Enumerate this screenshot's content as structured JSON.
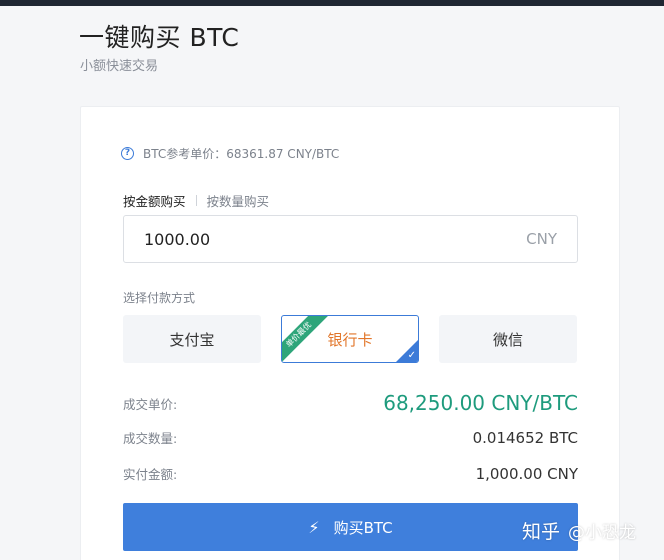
{
  "header": {
    "title": "一键购买 BTC",
    "subtitle": "小额快速交易"
  },
  "reference": {
    "text": "BTC参考单价：68361.87 CNY/BTC",
    "icon": "question-circle-icon"
  },
  "mode_tabs": {
    "by_amount": "按金额购买",
    "by_quantity": "按数量购买"
  },
  "amount": {
    "value": "1000.00",
    "unit": "CNY"
  },
  "payment": {
    "label": "选择付款方式",
    "options": [
      {
        "label": "支付宝"
      },
      {
        "label": "银行卡",
        "badge": "单价最优",
        "selected": true
      },
      {
        "label": "微信"
      }
    ]
  },
  "summary": {
    "unit_price_label": "成交单价:",
    "unit_price_value": "68,250.00 CNY/BTC",
    "quantity_label": "成交数量:",
    "quantity_value": "0.014652 BTC",
    "total_label": "实付金额:",
    "total_value": "1,000.00 CNY"
  },
  "buy_button": {
    "label": "购买BTC",
    "icon": "lightning-icon"
  },
  "watermark": {
    "brand": "知乎",
    "author": "@小恐龙"
  },
  "colors": {
    "accent": "#3f7fdc",
    "price": "#1e9b7d",
    "selected_text": "#e2762a",
    "badge": "#2ea57a"
  }
}
